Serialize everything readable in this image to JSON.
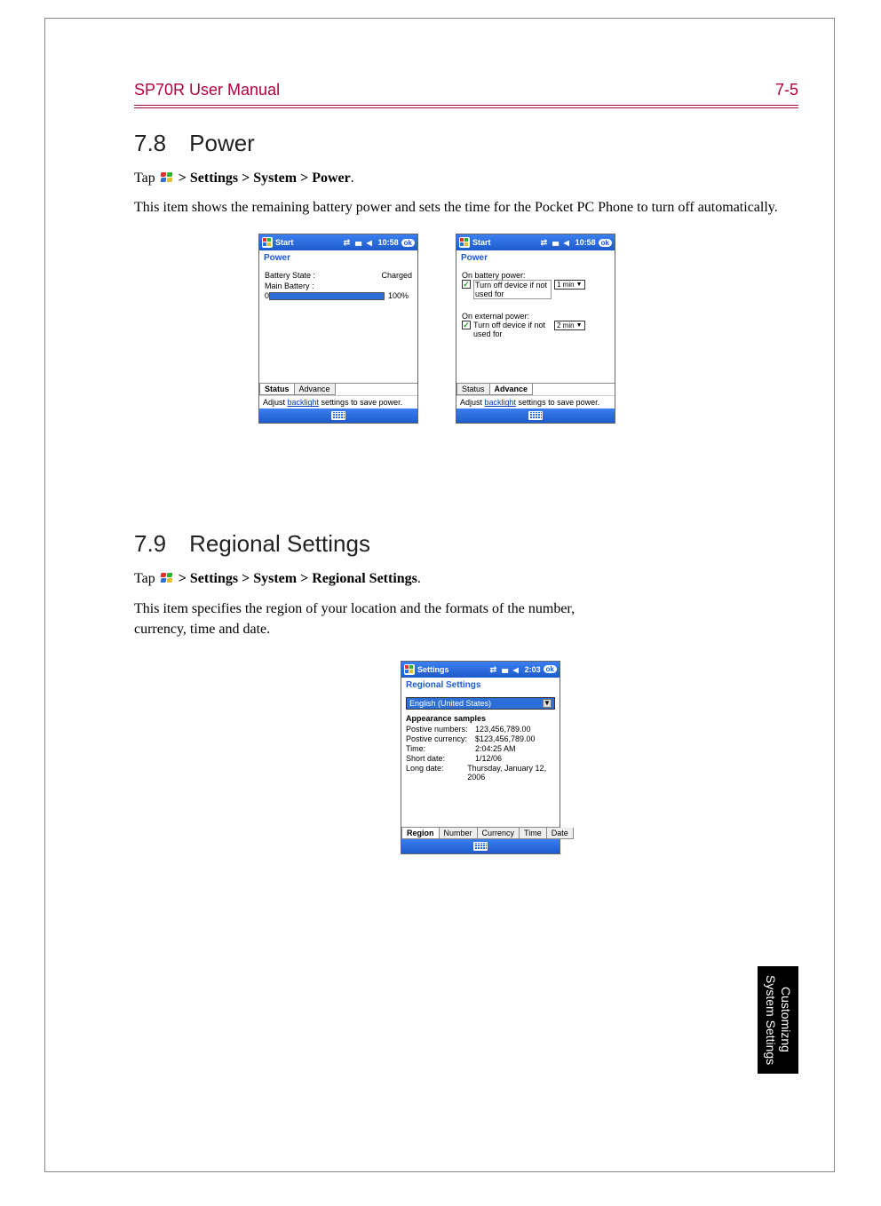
{
  "header": {
    "title": "SP70R User Manual",
    "page": "7-5"
  },
  "section1": {
    "heading": "7.8 Power",
    "tap_prefix": "Tap ",
    "tap_path": " > Settings > System > Power",
    "tap_suffix": ".",
    "desc": "This item shows the remaining battery power and sets the time for the Pocket PC Phone to turn off automatically."
  },
  "screenA": {
    "title": "Start",
    "time": "10:58",
    "ok": "ok",
    "subtitle": "Power",
    "battery_state_label": "Battery State :",
    "battery_state_value": "Charged",
    "main_label": "Main Battery :",
    "zero": "0",
    "pct": "100%",
    "tabs": [
      "Status",
      "Advance"
    ],
    "active_tab": 0,
    "hint_pre": "Adjust ",
    "hint_link": "backlight",
    "hint_post": " settings to save power."
  },
  "screenB": {
    "title": "Start",
    "time": "10:58",
    "ok": "ok",
    "subtitle": "Power",
    "blocks": [
      {
        "hdr": "On battery power:",
        "chk_label": "Turn off device if not used for",
        "dd": "1 min"
      },
      {
        "hdr": "On external power:",
        "chk_label": "Turn off device if not used for",
        "dd": "2 min"
      }
    ],
    "tabs": [
      "Status",
      "Advance"
    ],
    "active_tab": 1,
    "hint_pre": "Adjust ",
    "hint_link": "backlight",
    "hint_post": " settings to save power."
  },
  "section2": {
    "heading": "7.9 Regional Settings",
    "tap_prefix": "Tap ",
    "tap_path": " > Settings > System > Regional Settings",
    "tap_suffix": ".",
    "desc": "This item specifies the region of your location and the formats of the number, currency, time and date."
  },
  "screenC": {
    "title": "Settings",
    "time": "2:03",
    "ok": "ok",
    "subtitle": "Regional Settings",
    "region_value": "English (United States)",
    "samples_hd": "Appearance samples",
    "samples": [
      {
        "lbl": "Postive numbers:",
        "val": "123,456,789.00"
      },
      {
        "lbl": "Postive currency:",
        "val": "$123,456,789.00"
      },
      {
        "lbl": "Time:",
        "val": "2:04:25 AM"
      },
      {
        "lbl": "Short date:",
        "val": "1/12/06"
      },
      {
        "lbl": "Long date:",
        "val": "Thursday, January 12, 2006"
      }
    ],
    "tabs": [
      "Region",
      "Number",
      "Currency",
      "Time",
      "Date"
    ],
    "active_tab": 0
  },
  "side_tab": "Customizng\nSystem Settings"
}
